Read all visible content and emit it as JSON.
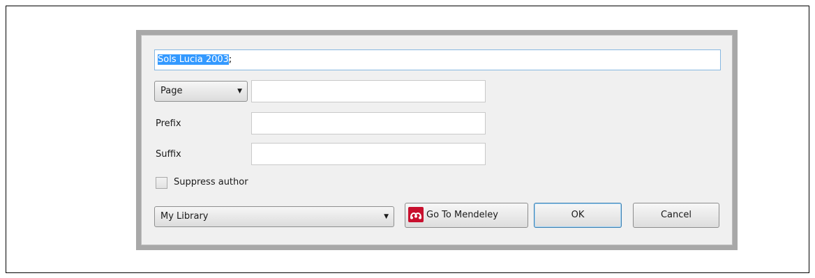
{
  "citation": {
    "selected_text": "Sols Lucia 2003",
    "trailing_text": ";"
  },
  "locator": {
    "type_selected": "Page",
    "value": ""
  },
  "prefix": {
    "label": "Prefix",
    "value": ""
  },
  "suffix": {
    "label": "Suffix",
    "value": ""
  },
  "suppress_author": {
    "label": "Suppress author",
    "checked": false
  },
  "library": {
    "selected": "My Library"
  },
  "buttons": {
    "go_to_mendeley": "Go To Mendeley",
    "ok": "OK",
    "cancel": "Cancel"
  },
  "icons": {
    "dropdown": "chevron-down-icon",
    "mendeley": "mendeley-logo-icon"
  },
  "colors": {
    "selection": "#3399ff",
    "focus_border": "#86b7e0",
    "mendeley_red": "#c8102e"
  }
}
